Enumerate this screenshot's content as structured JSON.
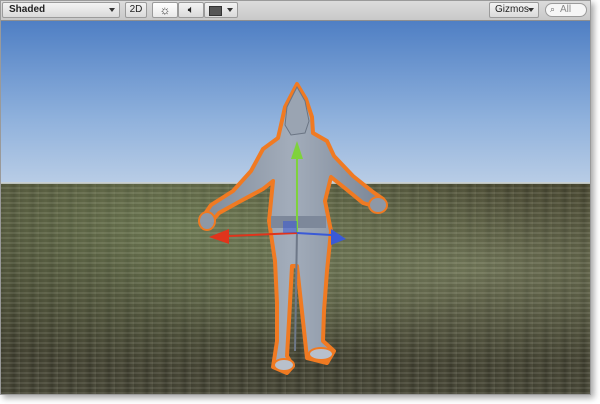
{
  "toolbar": {
    "draw_mode": "Shaded",
    "mode_2d": "2D",
    "lighting_icon": "sun-icon",
    "audio_icon": "speaker-icon",
    "effects_icon": "image-icon",
    "gizmos": "Gizmos",
    "search_placeholder": "All"
  },
  "scene": {
    "selected_object": "character-model",
    "outline_color": "#f07a22",
    "axis_colors": {
      "x": "#e0341c",
      "y": "#7fd23c",
      "z": "#3a5ad6"
    }
  }
}
